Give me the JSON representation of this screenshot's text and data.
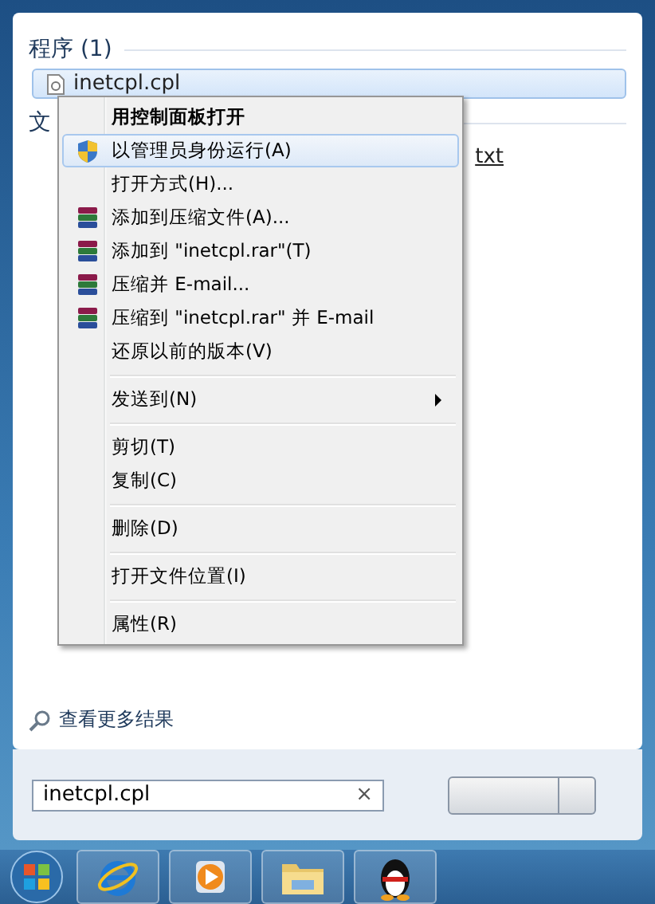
{
  "programs": {
    "heading": "程序 (1)",
    "items": [
      {
        "label": "inetcpl.cpl",
        "selected": true
      }
    ]
  },
  "files": {
    "heading": "文",
    "items": [
      {
        "label": "txt",
        "selected": false
      }
    ]
  },
  "context_menu": {
    "items": [
      {
        "kind": "default",
        "label": "用控制面板打开",
        "selected": false
      },
      {
        "kind": "admin",
        "label": "以管理员身份运行(A)",
        "selected": true
      },
      {
        "kind": "plain",
        "label": "打开方式(H)...",
        "selected": false
      },
      {
        "kind": "archive",
        "label": "添加到压缩文件(A)...",
        "selected": false
      },
      {
        "kind": "archive",
        "label": "添加到 \"inetcpl.rar\"(T)",
        "selected": false
      },
      {
        "kind": "archive",
        "label": "压缩并 E-mail...",
        "selected": false
      },
      {
        "kind": "archive",
        "label": "压缩到 \"inetcpl.rar\" 并 E-mail",
        "selected": false
      },
      {
        "kind": "plain",
        "label": "还原以前的版本(V)",
        "selected": false
      },
      {
        "kind": "separator"
      },
      {
        "kind": "submenu",
        "label": "发送到(N)",
        "selected": false
      },
      {
        "kind": "separator"
      },
      {
        "kind": "plain",
        "label": "剪切(T)",
        "selected": false
      },
      {
        "kind": "plain",
        "label": "复制(C)",
        "selected": false
      },
      {
        "kind": "separator"
      },
      {
        "kind": "plain",
        "label": "删除(D)",
        "selected": false
      },
      {
        "kind": "separator"
      },
      {
        "kind": "plain",
        "label": "打开文件位置(I)",
        "selected": false
      },
      {
        "kind": "separator"
      },
      {
        "kind": "plain",
        "label": "属性(R)",
        "selected": false
      }
    ]
  },
  "more_results": "查看更多结果",
  "search": {
    "value": "inetcpl.cpl",
    "clear": "×"
  },
  "taskbar": {
    "items": [
      {
        "kind": "browser",
        "selected": false
      },
      {
        "kind": "media",
        "selected": false
      },
      {
        "kind": "folder",
        "selected": false
      },
      {
        "kind": "penguin",
        "selected": false
      }
    ]
  }
}
